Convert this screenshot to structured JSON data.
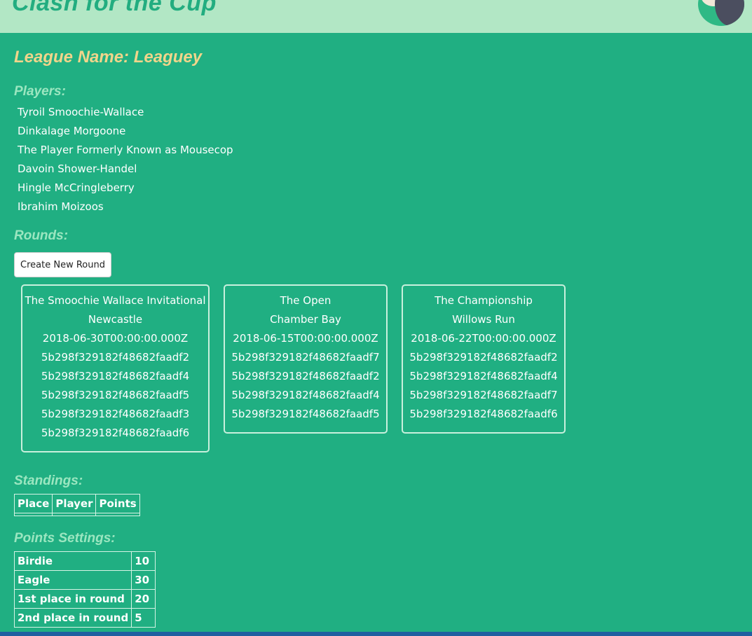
{
  "app": {
    "title": "Clash for the Cup"
  },
  "league": {
    "title": "League Name: Leaguey"
  },
  "players_section": {
    "title": "Players:",
    "players": [
      "Tyroil Smoochie-Wallace",
      "Dinkalage Morgoone",
      "The Player Formerly Known as Mousecop",
      "Davoin Shower-Handel",
      "Hingle McCringleberry",
      "Ibrahim Moizoos"
    ]
  },
  "rounds_section": {
    "title": "Rounds:",
    "create_button_label": "Create New Round",
    "rounds": [
      {
        "name": "The Smoochie Wallace Invitational",
        "course": "Newcastle",
        "date": "2018-06-30T00:00:00.000Z",
        "player_ids": [
          "5b298f329182f48682faadf2",
          "5b298f329182f48682faadf4",
          "5b298f329182f48682faadf5",
          "5b298f329182f48682faadf3",
          "5b298f329182f48682faadf6"
        ]
      },
      {
        "name": "The Open",
        "course": "Chamber Bay",
        "date": "2018-06-15T00:00:00.000Z",
        "player_ids": [
          "5b298f329182f48682faadf7",
          "5b298f329182f48682faadf2",
          "5b298f329182f48682faadf4",
          "5b298f329182f48682faadf5"
        ]
      },
      {
        "name": "The Championship",
        "course": "Willows Run",
        "date": "2018-06-22T00:00:00.000Z",
        "player_ids": [
          "5b298f329182f48682faadf2",
          "5b298f329182f48682faadf4",
          "5b298f329182f48682faadf7",
          "5b298f329182f48682faadf6"
        ]
      }
    ]
  },
  "standings_section": {
    "title": "Standings:",
    "headers": [
      "Place",
      "Player",
      "Points"
    ]
  },
  "points_section": {
    "title": "Points Settings:",
    "rows": [
      {
        "label": "Birdie",
        "value": "10"
      },
      {
        "label": "Eagle",
        "value": "30"
      },
      {
        "label": "1st place in round",
        "value": "20"
      },
      {
        "label": "2nd place in round",
        "value": "5"
      }
    ]
  }
}
